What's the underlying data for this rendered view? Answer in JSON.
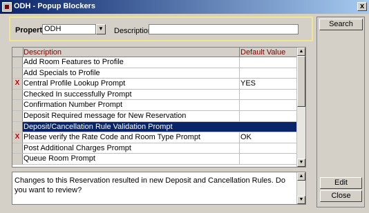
{
  "window": {
    "title": "ODH - Popup Blockers",
    "close_glyph": "x"
  },
  "filter": {
    "property_label": "Property",
    "property_value": "ODH",
    "description_label": "Description",
    "description_value": ""
  },
  "buttons": {
    "search": "Search",
    "edit": "Edit",
    "close": "Close"
  },
  "grid": {
    "columns": {
      "description": "Description",
      "default_value": "Default Value"
    },
    "rows": [
      {
        "mark": "",
        "description": "Add Room Features to Profile",
        "default_value": ""
      },
      {
        "mark": "",
        "description": "Add Specials to Profile",
        "default_value": ""
      },
      {
        "mark": "X",
        "description": "Central Profile Lookup Prompt",
        "default_value": "YES"
      },
      {
        "mark": "",
        "description": "Checked In successfully Prompt",
        "default_value": ""
      },
      {
        "mark": "",
        "description": "Confirmation Number Prompt",
        "default_value": ""
      },
      {
        "mark": "",
        "description": "Deposit Required message for New Reservation",
        "default_value": ""
      },
      {
        "mark": "",
        "description": "Deposit/Cancellation Rule Validation Prompt",
        "default_value": ""
      },
      {
        "mark": "X",
        "description": "Please verify the Rate Code and Room Type Prompt",
        "default_value": "OK"
      },
      {
        "mark": "",
        "description": "Post Additional Charges Prompt",
        "default_value": ""
      },
      {
        "mark": "",
        "description": "Queue Room Prompt",
        "default_value": ""
      }
    ],
    "selected_row": "Deposit/Cancellation Rule Validation Prompt"
  },
  "message": {
    "text": "Changes to this Reservation resulted in new Deposit and Cancellation Rules. Do you want to review?"
  },
  "colors": {
    "title_gradient_start": "#0a246a",
    "selection": "#0a246a",
    "header_text": "#800000",
    "mark": "#c00000",
    "filter_border": "#f0e68c"
  }
}
